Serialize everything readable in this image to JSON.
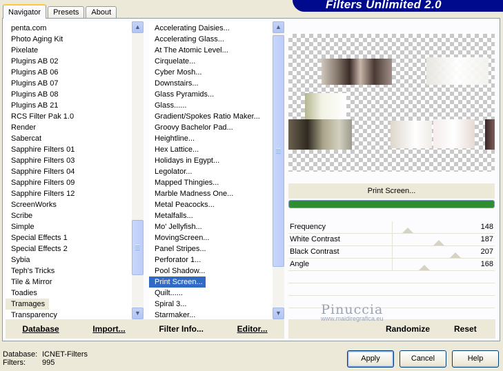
{
  "tabs": [
    "Navigator",
    "Presets",
    "About"
  ],
  "title": "Filters Unlimited 2.0",
  "categories": [
    "penta.com",
    "Photo Aging Kit",
    "Pixelate",
    "Plugins AB 02",
    "Plugins AB 06",
    "Plugins AB 07",
    "Plugins AB 08",
    "Plugins AB 21",
    "RCS Filter Pak 1.0",
    "Render",
    "Sabercat",
    "Sapphire Filters 01",
    "Sapphire Filters 03",
    "Sapphire Filters 04",
    "Sapphire Filters 09",
    "Sapphire Filters 12",
    "ScreenWorks",
    "Scribe",
    "Simple",
    "Special Effects 1",
    "Special Effects 2",
    "Sybia",
    "Teph's Tricks",
    "Tile & Mirror",
    "Toadies",
    "Tramages",
    "Transparency"
  ],
  "filters": [
    "Accelerating Daisies...",
    "Accelerating Glass...",
    "At The Atomic Level...",
    "Cirquelate...",
    "Cyber Mosh...",
    "Downstairs...",
    "Glass Pyramids...",
    "Glass......",
    "Gradient/Spokes Ratio Maker...",
    "Groovy Bachelor Pad...",
    "Heightline...",
    "Hex Lattice...",
    "Holidays in Egypt...",
    "Legolator...",
    "Mapped Thingies...",
    "Marble Madness One...",
    "Metal Peacocks...",
    "Metalfalls...",
    "Mo' Jellyfish...",
    "MovingScreen...",
    "Panel Stripes...",
    "Perforator 1...",
    "Pool Shadow...",
    "Print Screen...",
    "Quilt......",
    "Spiral 3...",
    "Starmaker..."
  ],
  "selected_category": "Tramages",
  "selected_filter": "Print Screen...",
  "left_buttons": {
    "database": "Database",
    "import": "Import...",
    "filter_info": "Filter Info...",
    "editor": "Editor..."
  },
  "filter_name": "Print Screen...",
  "progress_fraction": 1.0,
  "sliders": [
    {
      "label": "Frequency",
      "value": "148",
      "fraction": 0.58
    },
    {
      "label": "White Contrast",
      "value": "187",
      "fraction": 0.73
    },
    {
      "label": "Black Contrast",
      "value": "207",
      "fraction": 0.81
    },
    {
      "label": "Angle",
      "value": "168",
      "fraction": 0.66
    }
  ],
  "right_buttons": {
    "randomize": "Randomize",
    "reset": "Reset"
  },
  "watermark": {
    "name": "Pinuccia",
    "url": "www.maidiregrafica.eu"
  },
  "footer": {
    "database_label": "Database:",
    "database_value": "ICNET-Filters",
    "filters_label": "Filters:",
    "filters_value": "995"
  },
  "dialog_buttons": {
    "apply": "Apply",
    "cancel": "Cancel",
    "help": "Help"
  },
  "icons": {
    "scroll_up": "triangle-up-icon",
    "scroll_down": "triangle-down-icon"
  }
}
